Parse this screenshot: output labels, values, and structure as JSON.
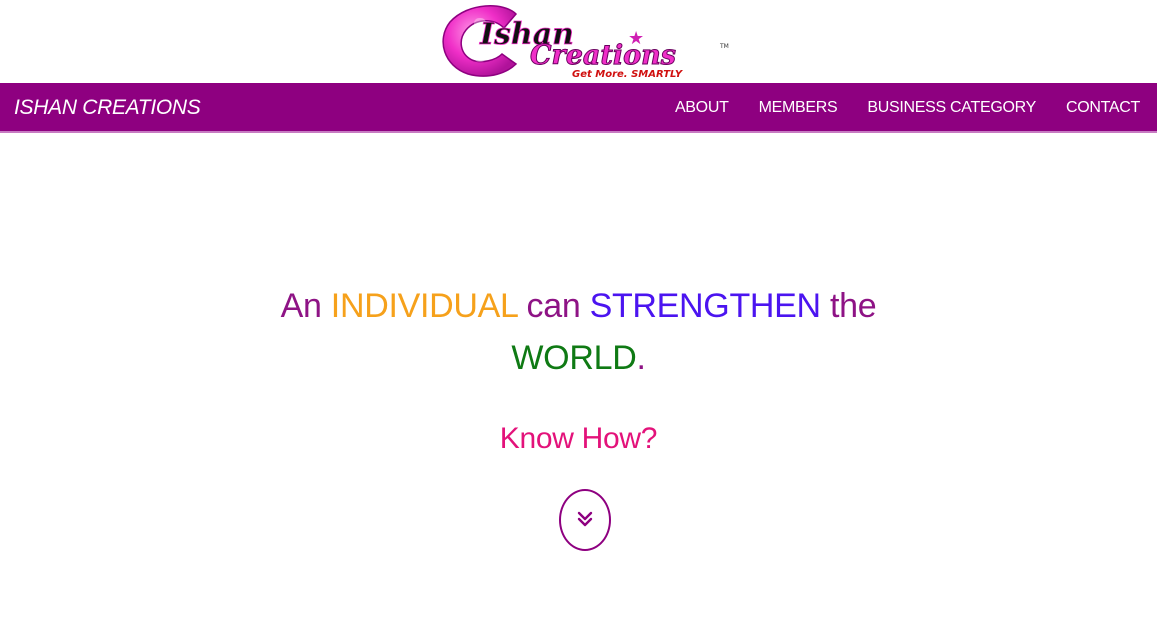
{
  "logo": {
    "line1": "Ishan",
    "line2": "Creations",
    "tagline": "Get More. SMARTLY",
    "trademark": "TM"
  },
  "navbar": {
    "brand": "ISHAN CREATIONS",
    "links": [
      {
        "label": "ABOUT"
      },
      {
        "label": "MEMBERS"
      },
      {
        "label": "BUSINESS CATEGORY"
      },
      {
        "label": "CONTACT"
      }
    ],
    "background_color": "#8e0080"
  },
  "hero": {
    "headline": {
      "part1": "An ",
      "individual": "INDIVIDUAL",
      "part2": " can ",
      "strengthen": "STRENGTHEN",
      "part3": " the",
      "world": "WORLD",
      "end": "."
    },
    "know_how": "Know How?",
    "scroll_icon": "double-chevron-down-icon",
    "colors": {
      "base": "#8e1385",
      "individual": "#f6a11b",
      "strengthen": "#4b14f0",
      "world": "#0f7a14",
      "know_how": "#e3127a"
    }
  }
}
